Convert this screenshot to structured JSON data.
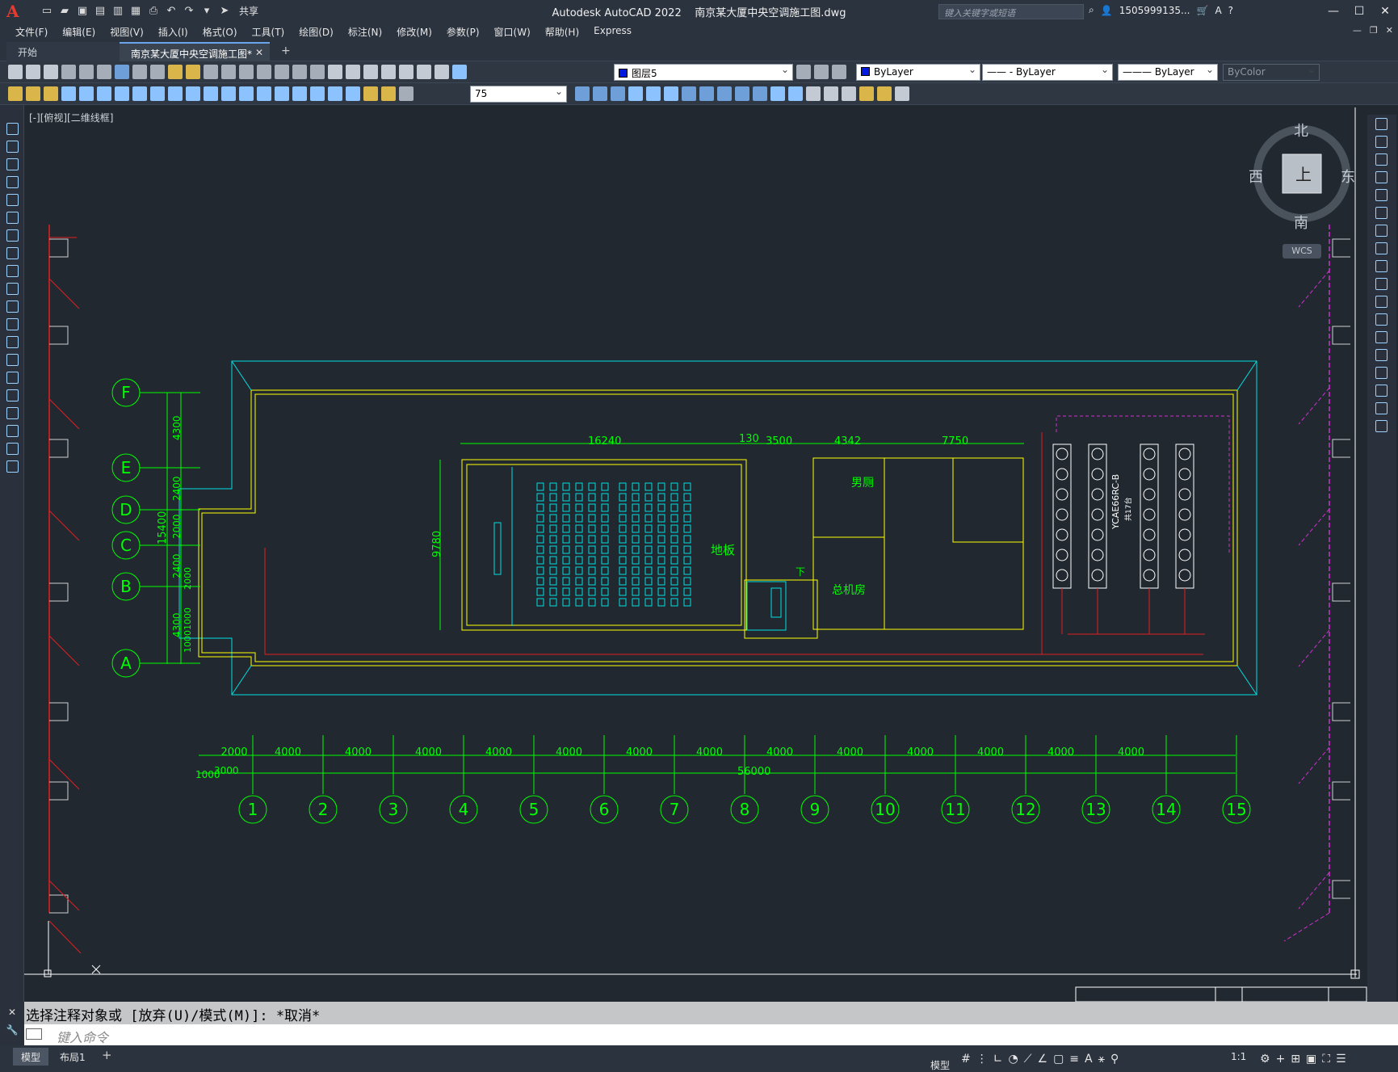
{
  "app": {
    "title": "Autodesk AutoCAD 2022    南京某大厦中央空调施工图.dwg",
    "logo": "A",
    "share_label": "共享",
    "search_placeholder": "键入关键字或短语",
    "user": "1505999135...",
    "window_buttons": [
      "—",
      "☐",
      "✕"
    ]
  },
  "menu": [
    "文件(F)",
    "编辑(E)",
    "视图(V)",
    "插入(I)",
    "格式(O)",
    "工具(T)",
    "绘图(D)",
    "标注(N)",
    "修改(M)",
    "参数(P)",
    "窗口(W)",
    "帮助(H)",
    "Express"
  ],
  "tabs": {
    "start": "开始",
    "active": "南京某大厦中央空调施工图*",
    "close": "✕",
    "add": "+"
  },
  "toolbar": {
    "layer": "图层5",
    "color": "ByLayer",
    "linetype": "ByLayer",
    "lineweight": "ByLayer",
    "plotstyle": "ByColor",
    "dimscale": "75"
  },
  "viewport": {
    "label": "[-][俯视][二维线框]",
    "viewcube": {
      "north": "北",
      "south": "南",
      "east": "东",
      "west": "西",
      "top": "上",
      "wcs": "WCS"
    }
  },
  "drawing": {
    "grid_rows": [
      "F",
      "E",
      "D",
      "C",
      "B",
      "A"
    ],
    "grid_cols": [
      "1",
      "2",
      "3",
      "4",
      "5",
      "6",
      "7",
      "8",
      "9",
      "10",
      "11",
      "12",
      "13",
      "14",
      "15"
    ],
    "bottom_dims": [
      "2000",
      "4000",
      "4000",
      "4000",
      "4000",
      "4000",
      "4000",
      "4000",
      "4000",
      "4000",
      "4000",
      "4000",
      "4000",
      "4000"
    ],
    "total_dim": "56000",
    "left_small": "1000",
    "left_small2": "3000",
    "left_dims": [
      "4300",
      "2400",
      "2000",
      "2400",
      "4300"
    ],
    "left_total": "15400",
    "left_dims_2": [
      "2000",
      "1000",
      "1000"
    ],
    "top_dims": [
      "16240",
      "130",
      "3500",
      "4342",
      "7750"
    ],
    "height_dim": "9780",
    "room_floor": "地板",
    "room_wc": "男厕",
    "room_machine": "总机房",
    "chiller_label": "YCAE66RC-B",
    "chiller_sub": "共17台",
    "stair_label": "下"
  },
  "command": {
    "history": "选择注释对象或 [放弃(U)/模式(M)]: *取消*",
    "placeholder": "键入命令"
  },
  "status": {
    "model_tab": "模型",
    "layout1": "布局1",
    "add": "+",
    "model_label": "模型",
    "scale": "1:1"
  }
}
